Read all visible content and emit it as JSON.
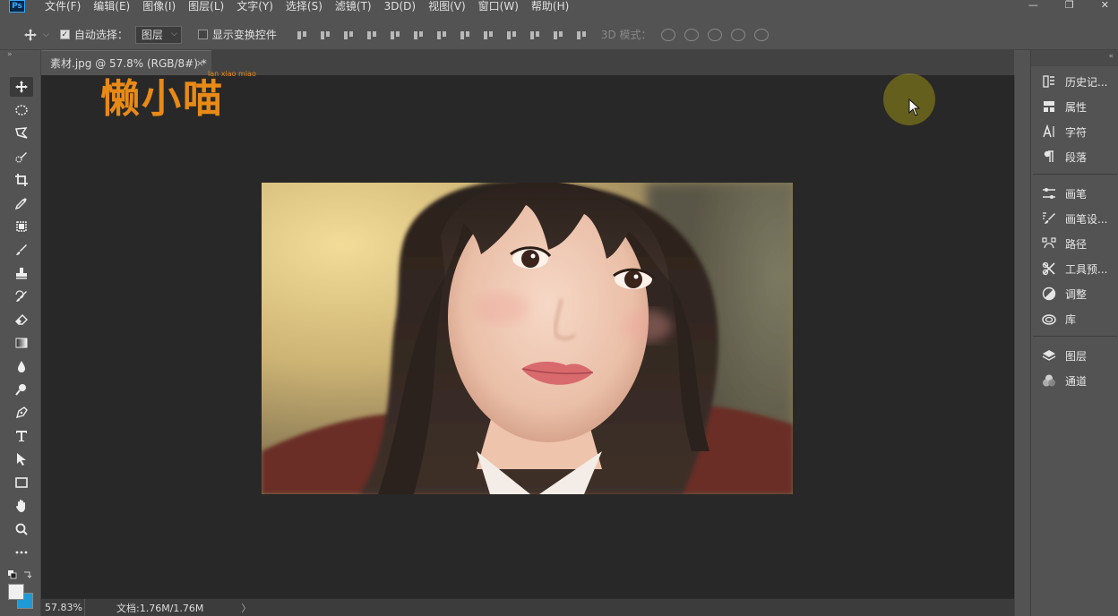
{
  "app": {
    "logo": "Ps"
  },
  "menubar": {
    "items": [
      "文件(F)",
      "编辑(E)",
      "图像(I)",
      "图层(L)",
      "文字(Y)",
      "选择(S)",
      "滤镜(T)",
      "3D(D)",
      "视图(V)",
      "窗口(W)",
      "帮助(H)"
    ]
  },
  "window_controls": {
    "minimize": "—",
    "maximize": "❐",
    "close": "✕"
  },
  "options": {
    "auto_select_label": "自动选择：",
    "auto_select_checked": true,
    "target_select_value": "图层",
    "show_transform_label": "显示变换控件",
    "show_transform_checked": false,
    "mode_3d_label": "3D 模式："
  },
  "document": {
    "tab_title": "素材.jpg @ 57.8% (RGB/8#) *",
    "close": "×"
  },
  "watermark": {
    "main": "懒小喵",
    "sub": "lan xiao miao"
  },
  "status": {
    "zoom": "57.83%",
    "doc_info": "文档:1.76M/1.76M",
    "arrow": "〉"
  },
  "tools": [
    "move-tool",
    "marquee-tool",
    "lasso-tool",
    "quick-select-tool",
    "crop-tool",
    "eyedropper-tool",
    "frame-tool",
    "brush-tool",
    "stamp-tool",
    "history-brush-tool",
    "eraser-tool",
    "gradient-tool",
    "blur-tool",
    "dodge-tool",
    "pen-tool",
    "type-tool",
    "path-select-tool",
    "rectangle-tool",
    "hand-tool",
    "zoom-tool",
    "more-tools"
  ],
  "panels": {
    "group1": [
      {
        "icon": "history-icon",
        "label": "历史记..."
      },
      {
        "icon": "properties-icon",
        "label": "属性"
      },
      {
        "icon": "character-icon",
        "label": "字符"
      },
      {
        "icon": "paragraph-icon",
        "label": "段落"
      }
    ],
    "group2": [
      {
        "icon": "brush-icon",
        "label": "画笔"
      },
      {
        "icon": "brush-settings-icon",
        "label": "画笔设..."
      },
      {
        "icon": "paths-icon",
        "label": "路径"
      },
      {
        "icon": "tool-presets-icon",
        "label": "工具预..."
      },
      {
        "icon": "adjustments-icon",
        "label": "调整"
      },
      {
        "icon": "libraries-icon",
        "label": "库"
      }
    ],
    "group3": [
      {
        "icon": "layers-icon",
        "label": "图层"
      },
      {
        "icon": "channels-icon",
        "label": "通道"
      }
    ]
  },
  "colors": {
    "foreground": "#f0f0f0",
    "background": "#1e9ad6",
    "watermark": "#e88a15"
  }
}
